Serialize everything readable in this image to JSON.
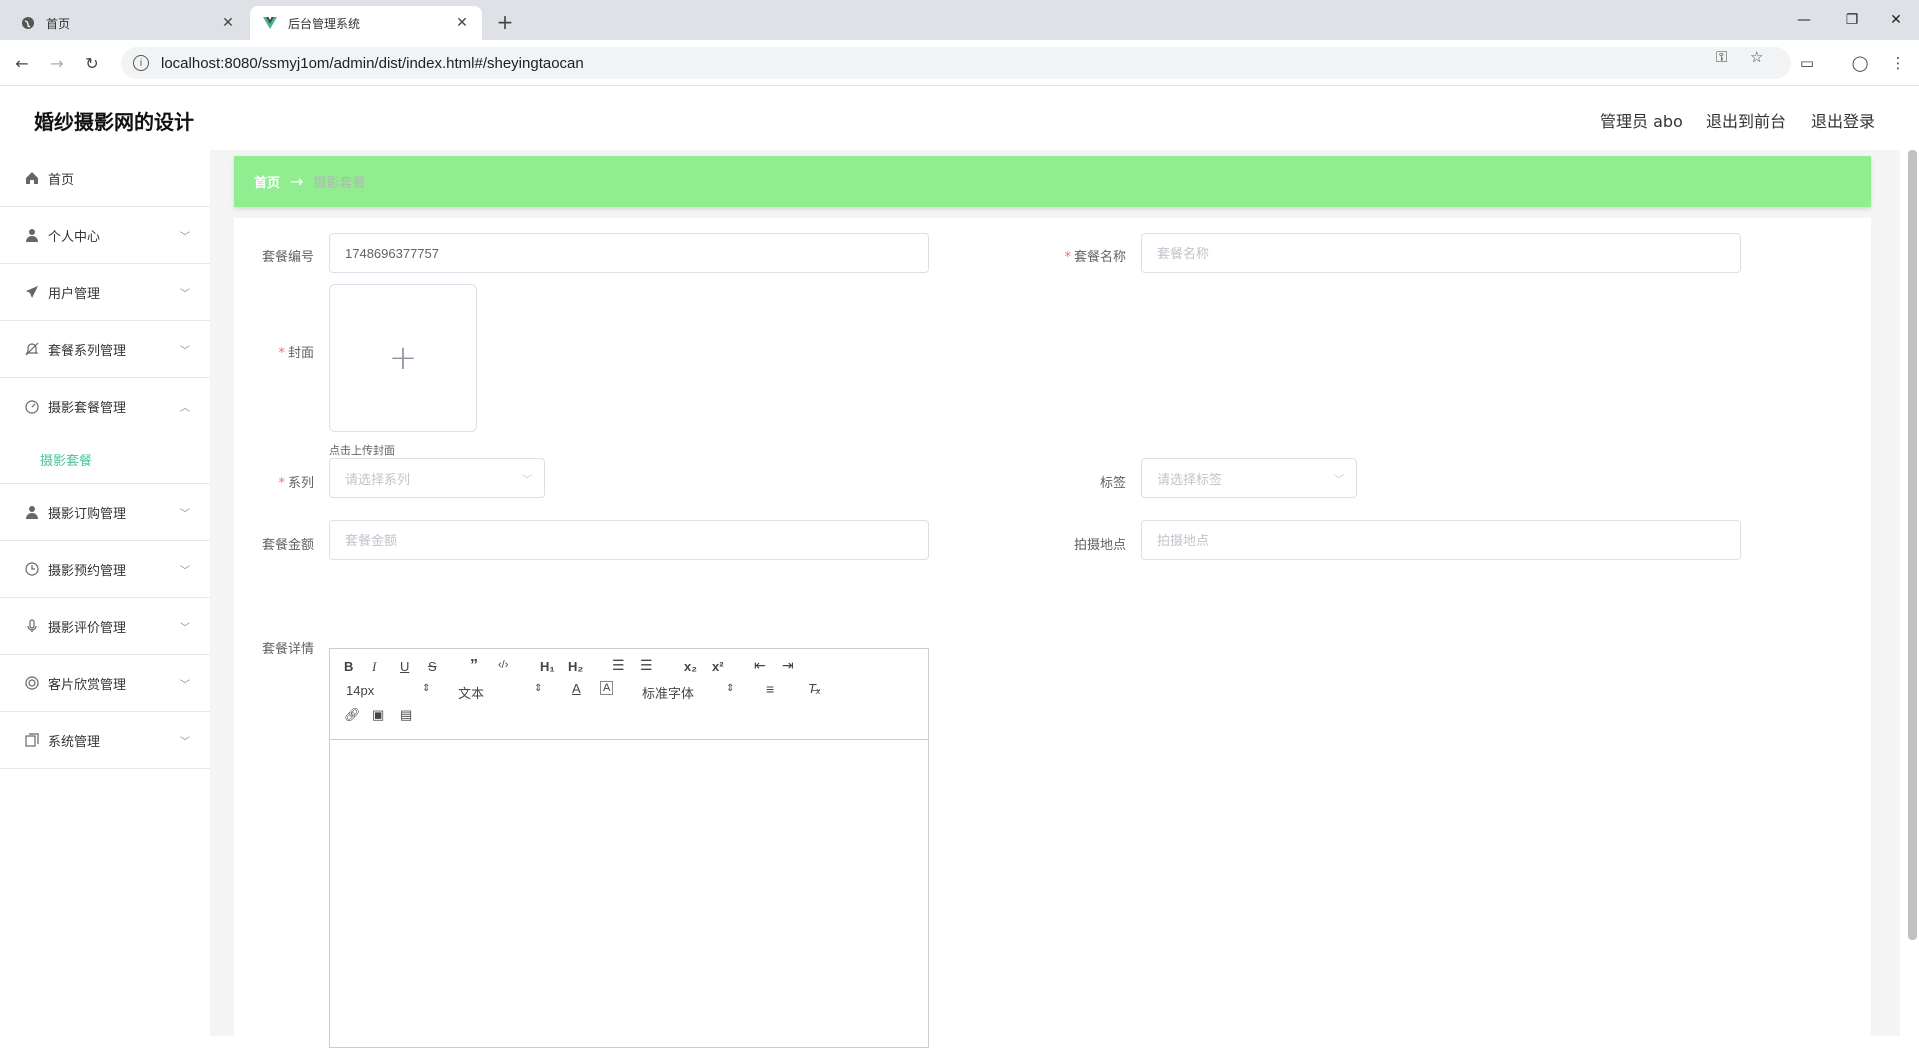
{
  "browser": {
    "tabs": [
      {
        "title": "首页",
        "active": false
      },
      {
        "title": "后台管理系统",
        "active": true
      }
    ],
    "url": "localhost:8080/ssmyj1om/admin/dist/index.html#/sheyingtaocan"
  },
  "header": {
    "brand": "婚纱摄影网的设计",
    "admin_label": "管理员 abo",
    "to_front": "退出到前台",
    "logout": "退出登录"
  },
  "sidebar": {
    "items": [
      {
        "label": "首页",
        "icon": "home-icon",
        "arrow": ""
      },
      {
        "label": "个人中心",
        "icon": "user-icon",
        "arrow": "chevron-down"
      },
      {
        "label": "用户管理",
        "icon": "send-icon",
        "arrow": "chevron-down"
      },
      {
        "label": "套餐系列管理",
        "icon": "bell-off-icon",
        "arrow": "chevron-down"
      },
      {
        "label": "摄影套餐管理",
        "icon": "gauge-icon",
        "arrow": "chevron-up"
      },
      {
        "label": "摄影订购管理",
        "icon": "user-icon",
        "arrow": "chevron-down"
      },
      {
        "label": "摄影预约管理",
        "icon": "clock-icon",
        "arrow": "chevron-down"
      },
      {
        "label": "摄影评价管理",
        "icon": "mic-icon",
        "arrow": "chevron-down"
      },
      {
        "label": "客片欣赏管理",
        "icon": "aperture-icon",
        "arrow": "chevron-down"
      },
      {
        "label": "系统管理",
        "icon": "copy-icon",
        "arrow": "chevron-down"
      }
    ],
    "sub_item": "摄影套餐"
  },
  "breadcrumb": {
    "home": "首页",
    "separator": "→",
    "current": "摄影套餐"
  },
  "form": {
    "code_label": "套餐编号",
    "code_value": "1748696377757",
    "name_label": "套餐名称",
    "name_placeholder": "套餐名称",
    "cover_label": "封面",
    "cover_hint": "点击上传封面",
    "series_label": "系列",
    "series_placeholder": "请选择系列",
    "tag_label": "标签",
    "tag_placeholder": "请选择标签",
    "price_label": "套餐金额",
    "price_placeholder": "套餐金额",
    "location_label": "拍摄地点",
    "location_placeholder": "拍摄地点",
    "detail_label": "套餐详情"
  },
  "editor": {
    "font_size": "14px",
    "header_select": "文本",
    "font_family": "标准字体"
  },
  "colors": {
    "breadcrumb_bg": "#90ee90",
    "accent": "#4cc2a0",
    "required": "#f56c6c"
  }
}
